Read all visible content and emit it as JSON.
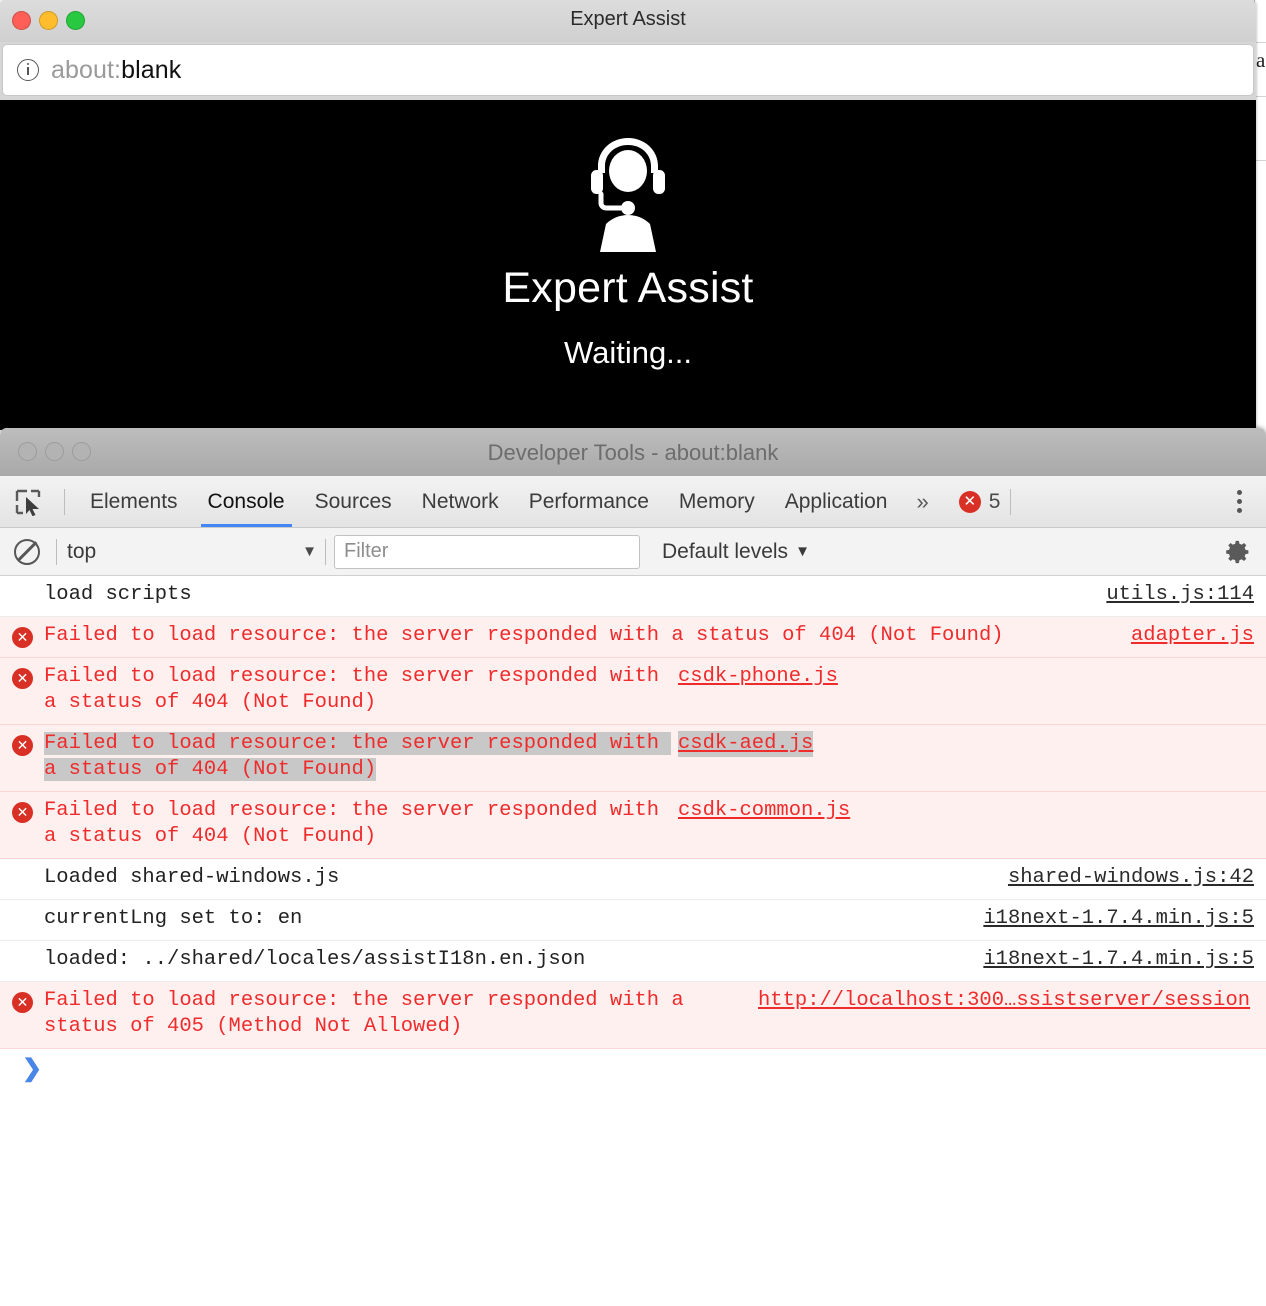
{
  "browser_window": {
    "title": "Expert Assist",
    "traffic_lights": [
      "close-button",
      "minimize-button",
      "maximize-button"
    ],
    "url": {
      "scheme": "about:",
      "host": "blank",
      "info_icon": "info-icon"
    },
    "page": {
      "icon": "headset-agent-icon",
      "title": "Expert Assist",
      "status": "Waiting..."
    }
  },
  "devtools_window": {
    "title": "Developer Tools - about:blank",
    "inspect_icon": "inspect-element-icon",
    "tabs": [
      {
        "label": "Elements",
        "active": false
      },
      {
        "label": "Console",
        "active": true
      },
      {
        "label": "Sources",
        "active": false
      },
      {
        "label": "Network",
        "active": false
      },
      {
        "label": "Performance",
        "active": false
      },
      {
        "label": "Memory",
        "active": false
      },
      {
        "label": "Application",
        "active": false
      }
    ],
    "more_tabs_label": "»",
    "error_badge": {
      "icon": "error-circle-icon",
      "glyph": "✕",
      "count": "5"
    },
    "kebab_menu": "more-options-icon",
    "console_toolbar": {
      "clear_icon": "clear-console-icon",
      "context": "top",
      "context_caret": "▼",
      "filter_placeholder": "Filter",
      "filter_value": "",
      "levels_label": "Default levels",
      "levels_caret": "▼",
      "settings_icon": "settings-gear-icon"
    },
    "console_messages": [
      {
        "level": "info",
        "text": "load scripts",
        "source": "utils.js:114",
        "width": "wide",
        "selected": false
      },
      {
        "level": "error",
        "text": "Failed to load resource: the server responded with a status of 404 (Not Found)",
        "source": "adapter.js",
        "width": "wide",
        "selected": false
      },
      {
        "level": "error",
        "text": "Failed to load resource: the server responded with a status of 404 (Not Found)",
        "source": "csdk-phone.js",
        "width": "narrow",
        "selected": false
      },
      {
        "level": "error",
        "text": "Failed to load resource: the server responded with a status of 404 (Not Found)",
        "source": "csdk-aed.js",
        "width": "narrow",
        "selected": true
      },
      {
        "level": "error",
        "text": "Failed to load resource: the server responded with a status of 404 (Not Found)",
        "source": "csdk-common.js",
        "width": "narrow",
        "selected": false
      },
      {
        "level": "info",
        "text": "Loaded shared-windows.js",
        "source": "shared-windows.js:42",
        "width": "wide",
        "selected": false
      },
      {
        "level": "info",
        "text": "currentLng set to: en",
        "source": "i18next-1.7.4.min.js:5",
        "width": "wide",
        "selected": false
      },
      {
        "level": "info",
        "text": "loaded: ../shared/locales/assistI18n.en.json",
        "source": "i18next-1.7.4.min.js:5",
        "width": "wide",
        "selected": false
      },
      {
        "level": "error",
        "text": "Failed to load resource: the server responded with a status of 405 (Method Not Allowed)",
        "source": "http://localhost:300…ssistserver/session",
        "width": "mid",
        "selected": false
      }
    ],
    "prompt_chevron": "❯"
  },
  "colors": {
    "error_red": "#ef2b2b",
    "error_badge": "#d93025",
    "accent_blue": "#4285f4",
    "prompt_blue": "#4a86e8",
    "error_row_bg": "#fff0f0",
    "selection_gray": "#c8c8c8"
  }
}
